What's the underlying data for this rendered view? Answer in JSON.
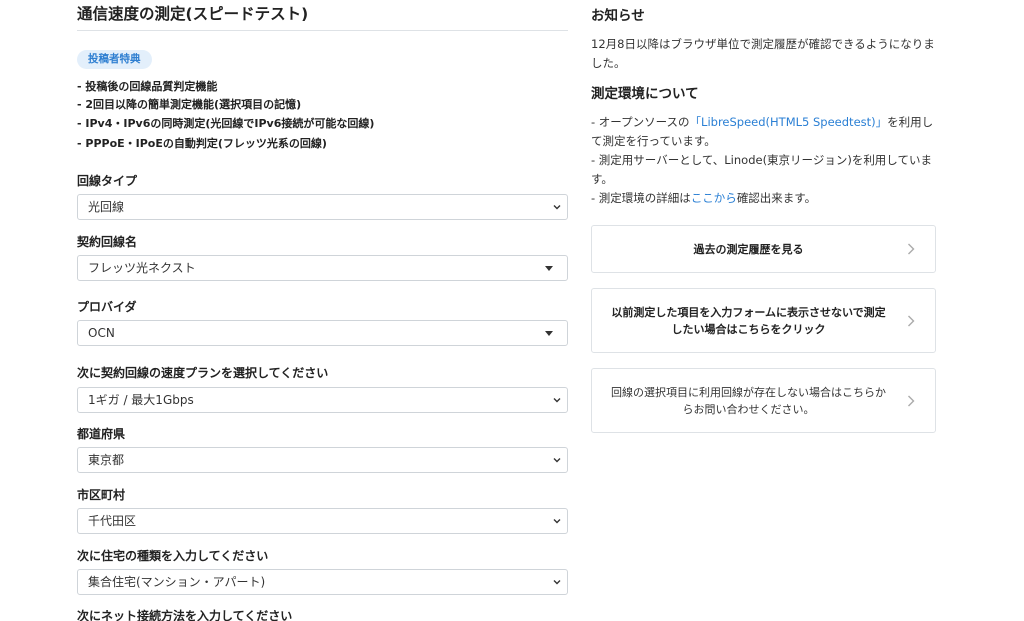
{
  "left": {
    "title": "通信速度の測定(スピードテスト)",
    "badge": "投稿者特典",
    "benefits": [
      "- 投稿後の回線品質判定機能",
      "- 2回目以降の簡単測定機能(選択項目の記憶)",
      "- IPv4・IPv6の同時測定(光回線でIPv6接続が可能な回線)",
      "- PPPoE・IPoEの自動判定(フレッツ光系の回線)"
    ],
    "fields": {
      "line_type": {
        "label": "回線タイプ",
        "value": "光回線"
      },
      "contract_line": {
        "label": "契約回線名",
        "value": "フレッツ光ネクスト"
      },
      "provider": {
        "label": "プロバイダ",
        "value": "OCN"
      },
      "speed_plan": {
        "label": "次に契約回線の速度プランを選択してください",
        "value": "1ギガ / 最大1Gbps"
      },
      "prefecture": {
        "label": "都道府県",
        "value": "東京都"
      },
      "city": {
        "label": "市区町村",
        "value": "千代田区"
      },
      "housing": {
        "label": "次に住宅の種類を入力してください",
        "value": "集合住宅(マンション・アパート)"
      },
      "connection_method": {
        "label": "次にネット接続方法を入力してください"
      }
    }
  },
  "right": {
    "notice_title": "お知らせ",
    "notice_text": "12月8日以降はブラウザ単位で測定履歴が確認できるようになりました。",
    "env_title": "測定環境について",
    "env_line1_pre": "- オープンソースの",
    "env_line1_link": "「LibreSpeed(HTML5 Speedtest)」",
    "env_line1_post": "を利用して測定を行っています。",
    "env_line2": "- 測定用サーバーとして、Linode(東京リージョン)を利用しています。",
    "env_line3_pre": "- 測定環境の詳細は",
    "env_line3_link": "ここから",
    "env_line3_post": "確認出来ます。",
    "cards": [
      {
        "label": "過去の測定履歴を見る"
      },
      {
        "label": "以前測定した項目を入力フォームに表示させないで測定したい場合はこちらをクリック"
      },
      {
        "label": "回線の選択項目に利用回線が存在しない場合はこちらからお問い合わせください。"
      }
    ]
  },
  "icons": {
    "select_chevron": "chevron-down-icon",
    "select_caret": "caret-down-icon",
    "card_arrow": "chevron-right-icon"
  },
  "colors": {
    "link": "#2a7fd4",
    "badge_bg": "#e3effb",
    "badge_text": "#2f7fd1",
    "border": "#dee2e6"
  }
}
